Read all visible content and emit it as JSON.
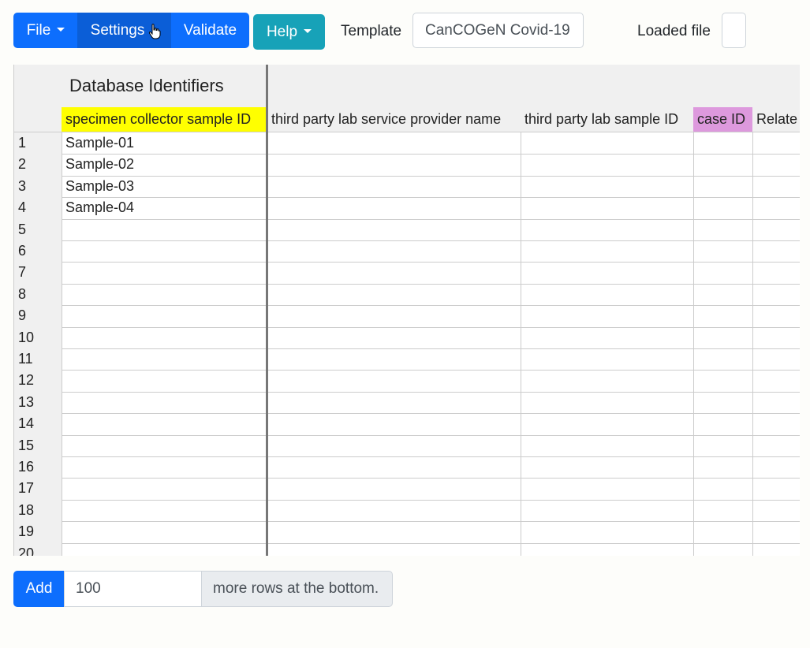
{
  "toolbar": {
    "file_label": "File",
    "settings_label": "Settings",
    "validate_label": "Validate",
    "help_label": "Help",
    "template_label": "Template",
    "template_value": "CanCOGeN Covid-19",
    "loaded_file_label": "Loaded file",
    "loaded_file_value": ""
  },
  "grid": {
    "section_header": "Database Identifiers",
    "columns": [
      "specimen collector sample ID",
      "third party lab service provider name",
      "third party lab sample ID",
      "case ID",
      "Relate"
    ],
    "column_colors": {
      "specimen collector sample ID": "#ffff00",
      "case ID": "#dd99dd"
    },
    "row_numbers": [
      "1",
      "2",
      "3",
      "4",
      "5",
      "6",
      "7",
      "8",
      "9",
      "10",
      "11",
      "12",
      "13",
      "14",
      "15",
      "16",
      "17",
      "18",
      "19",
      "20"
    ],
    "samples": [
      "Sample-01",
      "Sample-02",
      "Sample-03",
      "Sample-04"
    ]
  },
  "add_rows": {
    "button_label": "Add",
    "count_value": "100",
    "suffix_text": "more rows at the bottom."
  }
}
